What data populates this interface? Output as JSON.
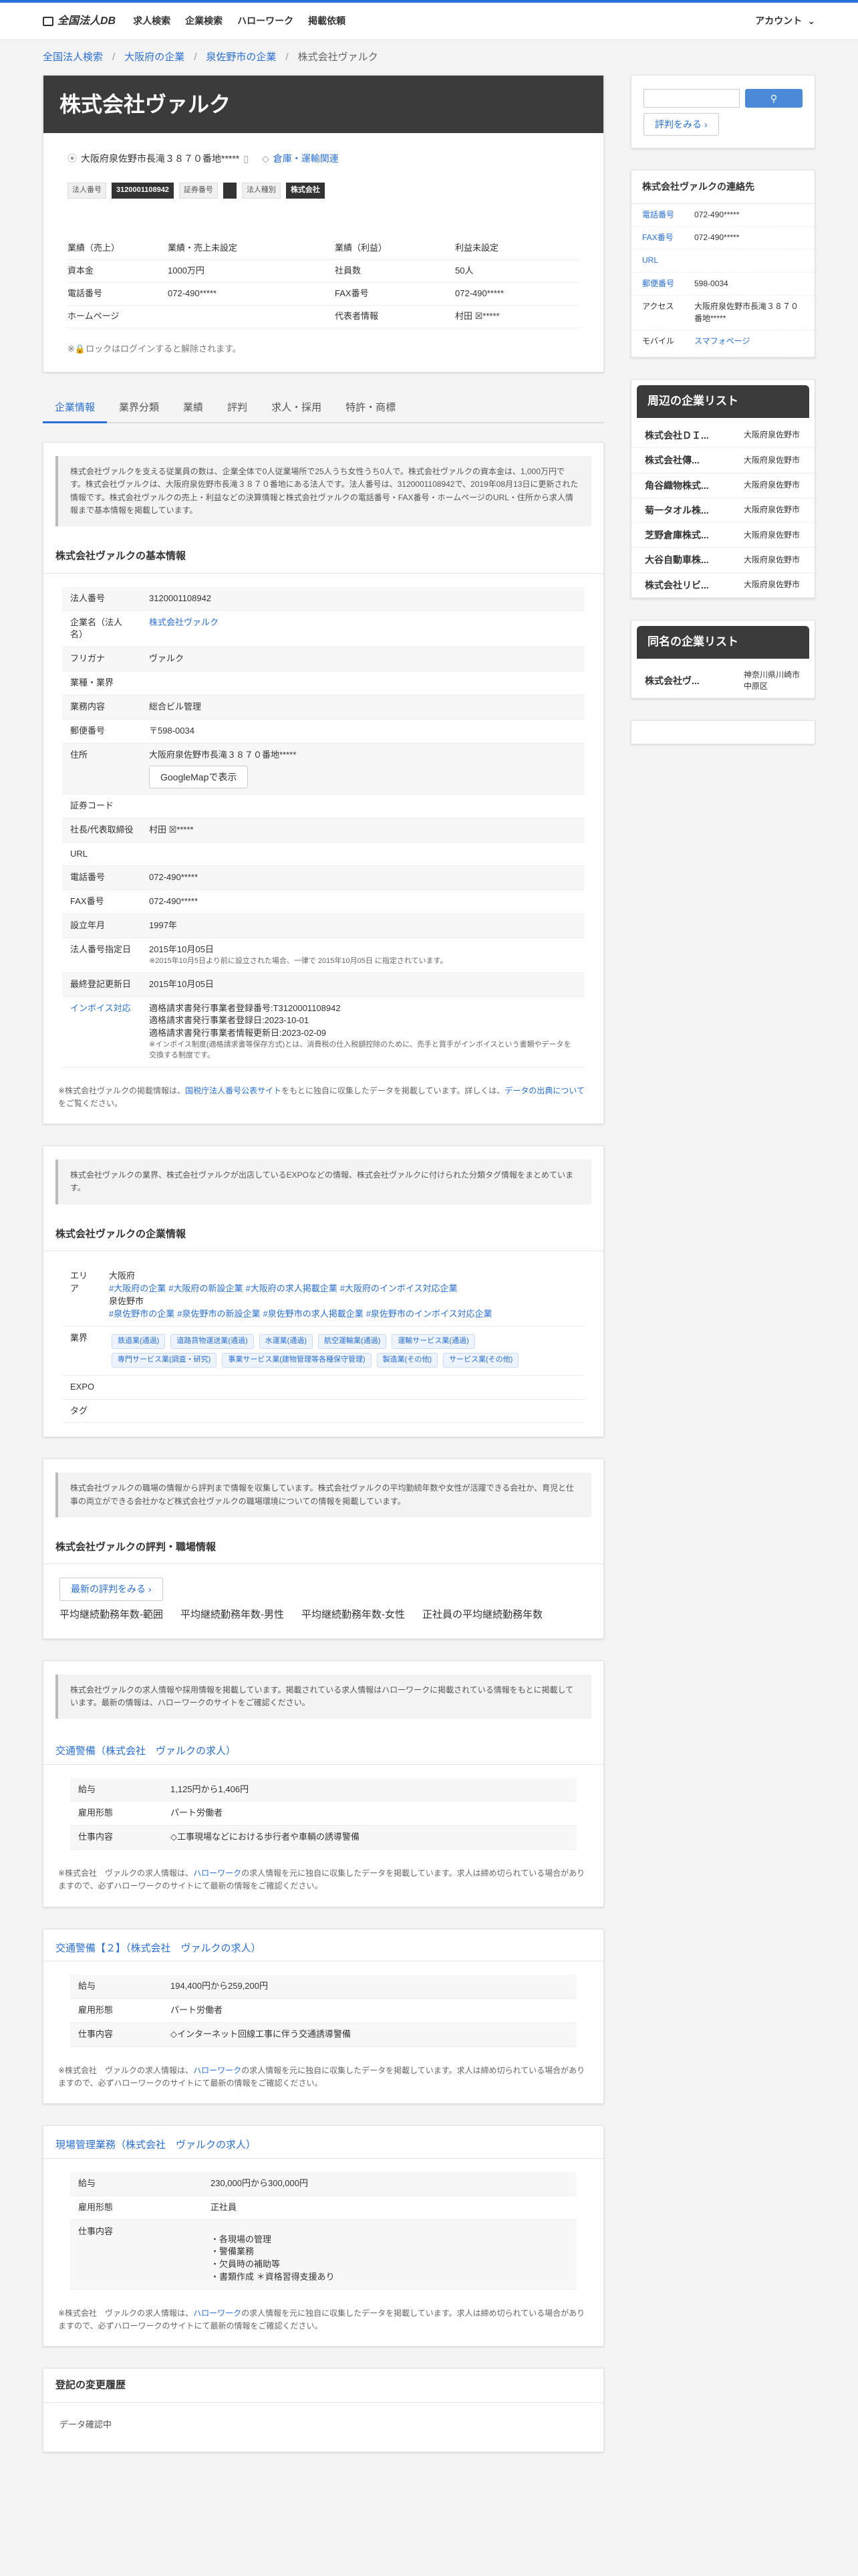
{
  "nav": {
    "logo": "全国法人DB",
    "items": [
      "求人検索",
      "企業検索",
      "ハローワーク",
      "掲載依頼"
    ],
    "account": "アカウント"
  },
  "breadcrumb": [
    "全国法人検索",
    "大阪府の企業",
    "泉佐野市の企業",
    "株式会社ヴァルク"
  ],
  "company": {
    "name": "株式会社ヴァルク",
    "address": "大阪府泉佐野市長滝３８７０番地*****",
    "category_link": "倉庫・運輸関連",
    "tags": [
      {
        "label": "法人番号",
        "value": "3120001108942"
      },
      {
        "label": "証券番号",
        "value": ""
      },
      {
        "label": "法人種別",
        "value": "株式会社"
      }
    ]
  },
  "summary": [
    [
      "業績（売上）",
      "業績・売上未設定",
      "業績（利益）",
      "利益未設定"
    ],
    [
      "資本金",
      "1000万円",
      "社員数",
      "50人"
    ],
    [
      "電話番号",
      "072-490*****",
      "FAX番号",
      "072-490*****"
    ],
    [
      "ホームページ",
      "",
      "代表者情報",
      "村田 ☒*****"
    ]
  ],
  "lock_note": "※🔒ロックはログインすると解除されます。",
  "tabs": [
    "企業情報",
    "業界分類",
    "業績",
    "評判",
    "求人・採用",
    "特許・商標"
  ],
  "intro1": "株式会社ヴァルクを支える従業員の数は、企業全体で0人従業場所で25人うち女性うち0人で。株式会社ヴァルクの資本金は、1,000万円です。株式会社ヴァルクは、大阪府泉佐野市長滝３８７０番地にある法人です。法人番号は、3120001108942で、2019年08月13日に更新された情報です。株式会社ヴァルクの売上・利益などの決算情報と株式会社ヴァルクの電話番号・FAX番号・ホームページのURL・住所から求人情報まで基本情報を掲載しています。",
  "basic": {
    "title": "株式会社ヴァルクの基本情報",
    "rows": [
      [
        "法人番号",
        "3120001108942"
      ],
      [
        "企業名（法人名）",
        "株式会社ヴァルク"
      ],
      [
        "フリガナ",
        "ヴァルク"
      ],
      [
        "業種・業界",
        ""
      ],
      [
        "業務内容",
        "総合ビル管理"
      ],
      [
        "郵便番号",
        "〒598-0034"
      ],
      [
        "住所",
        "大阪府泉佐野市長滝３８７０番地*****"
      ],
      [
        "証券コード",
        ""
      ],
      [
        "社長/代表取締役",
        "村田 ☒*****"
      ],
      [
        "URL",
        ""
      ],
      [
        "電話番号",
        "072-490*****"
      ],
      [
        "FAX番号",
        "072-490*****"
      ],
      [
        "設立年月",
        "1997年"
      ],
      [
        "法人番号指定日",
        "2015年10月05日"
      ],
      [
        "最終登記更新日",
        "2015年10月05日"
      ]
    ],
    "map_btn": "GoogleMapで表示",
    "designation_note": "※2015年10月5日より前に設立された場合、一律で 2015年10月05日 に指定されています。",
    "invoice_label": "インボイス対応",
    "invoice_lines": [
      "適格請求書発行事業者登録番号:T3120001108942",
      "適格請求書発行事業者登録日:2023-10-01",
      "適格請求書発行事業者情報更新日:2023-02-09"
    ],
    "invoice_note": "※インボイス制度(適格請求書等保存方式)とは、消費税の仕入税額控除のために、売手と買手がインボイスという書類やデータを交換する制度です。",
    "footnote_a": "※株式会社ヴァルクの掲載情報は、",
    "footnote_link": "国税庁法人番号公表サイト",
    "footnote_b": "をもとに独自に収集したデータを掲載しています。詳しくは、",
    "footnote_link2": "データの出典について",
    "footnote_c": "をご覧ください。"
  },
  "intro2": "株式会社ヴァルクの業界、株式会社ヴァルクが出店しているEXPOなどの情報、株式会社ヴァルクに付けられた分類タグ情報をまとめています。",
  "industry": {
    "title": "株式会社ヴァルクの企業情報",
    "area_label": "エリア",
    "pref": "大阪府",
    "pref_tags": [
      "#大阪府の企業",
      "#大阪府の新設企業",
      "#大阪府の求人掲載企業",
      "#大阪府のインボイス対応企業"
    ],
    "city": "泉佐野市",
    "city_tags": [
      "#泉佐野市の企業",
      "#泉佐野市の新設企業",
      "#泉佐野市の求人掲載企業",
      "#泉佐野市のインボイス対応企業"
    ],
    "industry_label": "業界",
    "chips": [
      "鉄道業(通過)",
      "道路貨物運送業(通過)",
      "水運業(通過)",
      "航空運輸業(通過)",
      "運輸サービス業(通過)",
      "専門サービス業(調査・研究)",
      "事業サービス業(建物管理等各種保守管理)",
      "製造業(その他)",
      "サービス業(その他)"
    ],
    "expo_label": "EXPO",
    "tag_label": "タグ"
  },
  "intro3": "株式会社ヴァルクの職場の情報から評判まで情報を収集しています。株式会社ヴァルクの平均勤続年数や女性が活躍できる会社か、育児と仕事の両立ができる会社かなど株式会社ヴァルクの職場環境についての情報を掲載しています。",
  "review": {
    "title": "株式会社ヴァルクの評判・職場情報",
    "btn": "最新の評判をみる",
    "labels": [
      "平均継続勤務年数-範囲",
      "平均継続勤務年数-男性",
      "平均継続勤務年数-女性",
      "正社員の平均継続勤務年数"
    ]
  },
  "intro4": "株式会社ヴァルクの求人情報や採用情報を掲載しています。掲載されている求人情報はハローワークに掲載されている情報をもとに掲載しています。最新の情報は、ハローワークのサイトをご確認ください。",
  "jobs": [
    {
      "title": "交通警備（株式会社　ヴァルクの求人）",
      "rows": [
        [
          "給与",
          "1,125円から1,406円"
        ],
        [
          "雇用形態",
          "パート労働者"
        ],
        [
          "仕事内容",
          "◇工事現場などにおける歩行者や車輌の誘導警備"
        ]
      ]
    },
    {
      "title": "交通警備【２】（株式会社　ヴァルクの求人）",
      "rows": [
        [
          "給与",
          "194,400円から259,200円"
        ],
        [
          "雇用形態",
          "パート労働者"
        ],
        [
          "仕事内容",
          "◇インターネット回線工事に伴う交通誘導警備"
        ]
      ]
    },
    {
      "title": "現場管理業務（株式会社　ヴァルクの求人）",
      "rows": [
        [
          "給与",
          "230,000円から300,000円"
        ],
        [
          "雇用形態",
          "正社員"
        ],
        [
          "仕事内容",
          "・各現場の管理\n・警備業務\n・欠員時の補助等\n・書類作成 ＊資格習得支援あり"
        ]
      ]
    }
  ],
  "job_note_a": "※株式会社　ヴァルクの求人情報は、",
  "job_note_link": "ハローワーク",
  "job_note_b": "の求人情報を元に独自に収集したデータを掲載しています。求人は締め切られている場合がありますので、必ずハローワークのサイトにて最新の情報をご確認ください。",
  "history": {
    "title": "登記の変更履歴",
    "body": "データ確認中"
  },
  "side": {
    "review_btn": "評判をみる",
    "contact_title": "株式会社ヴァルクの連絡先",
    "contact": [
      [
        "電話番号",
        "072-490*****"
      ],
      [
        "FAX番号",
        "072-490*****"
      ],
      [
        "URL",
        ""
      ],
      [
        "郵便番号",
        "598-0034"
      ],
      [
        "アクセス",
        "大阪府泉佐野市長滝３８７０番地*****"
      ],
      [
        "モバイル",
        "スマフォページ"
      ]
    ],
    "near_title": "周辺の企業リスト",
    "near": [
      [
        "株式会社ＤＩ...",
        "大阪府泉佐野市"
      ],
      [
        "株式会社傳...",
        "大阪府泉佐野市"
      ],
      [
        "角谷織物株式...",
        "大阪府泉佐野市"
      ],
      [
        "菊一タオル株...",
        "大阪府泉佐野市"
      ],
      [
        "芝野倉庫株式...",
        "大阪府泉佐野市"
      ],
      [
        "大谷自動車株...",
        "大阪府泉佐野市"
      ],
      [
        "株式会社リビ...",
        "大阪府泉佐野市"
      ]
    ],
    "same_title": "同名の企業リスト",
    "same": [
      [
        "株式会社ヴ...",
        "神奈川県川崎市中原区"
      ]
    ]
  }
}
